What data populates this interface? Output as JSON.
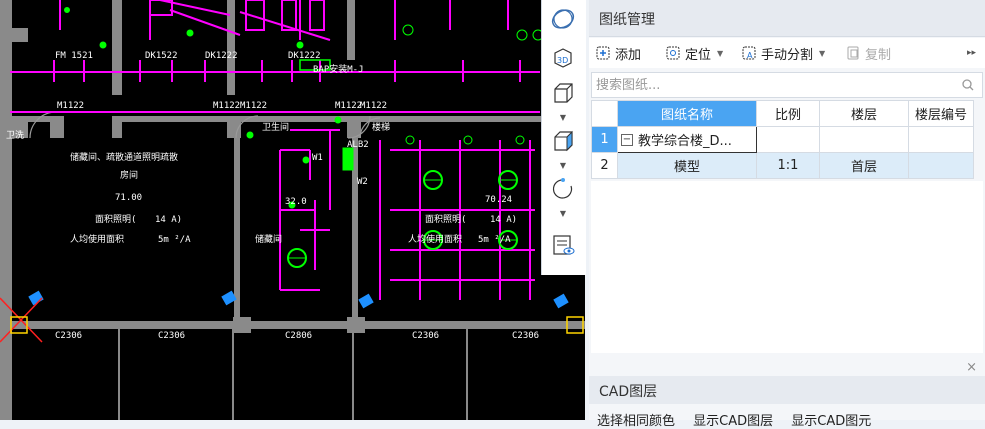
{
  "canvas": {
    "labels": [
      "FM 1521",
      "DK1522",
      "DK1222",
      "DK1222",
      "BAP安装M-J",
      "M1122",
      "M1122",
      "M1122",
      "M1122",
      "M1122",
      "卫洗",
      "卫生间",
      "楼梯",
      "ALB2",
      "W1",
      "W2",
      "储藏间、疏散通道照明疏散",
      "房间",
      "71.00",
      "面积照明(",
      "14 A)",
      "人均使用面积",
      "5m ²/A",
      "70.24",
      "面积照明(",
      "14 A)",
      "人均使用面积",
      "5m ²/A",
      "储藏间",
      "C2306",
      "C2306",
      "C2806",
      "C2306",
      "C2306",
      "32.0"
    ]
  },
  "view_toolbar": {
    "icons": [
      "orbit-icon",
      "3d-view-icon",
      "box-wireframe-icon",
      "box-solid-icon",
      "rotate-icon",
      "layer-visibility-icon"
    ]
  },
  "drawing_panel": {
    "title": "图纸管理",
    "toolbar": {
      "add": "添加",
      "locate": "定位",
      "manual_split": "手动分割",
      "copy": "复制",
      "more": "▸▸"
    },
    "search_placeholder": "搜索图纸...",
    "table": {
      "headers": [
        "图纸名称",
        "比例",
        "楼层",
        "楼层编号"
      ],
      "rows": [
        {
          "num": "1",
          "name": "教学综合楼_D...",
          "scale": "",
          "floor": "",
          "floor_no": "",
          "expander": "−"
        },
        {
          "num": "2",
          "name": "模型",
          "scale": "1:1",
          "floor": "首层",
          "floor_no": ""
        }
      ]
    }
  },
  "cad_layer_panel": {
    "title": "CAD图层",
    "close": "×",
    "options": [
      "选择相同颜色",
      "显示CAD图层",
      "显示CAD图元"
    ]
  },
  "colors": {
    "accent": "#4aa4f2",
    "wall": "#808080",
    "circuit": "#ff00ff",
    "device": "#00ff00"
  }
}
